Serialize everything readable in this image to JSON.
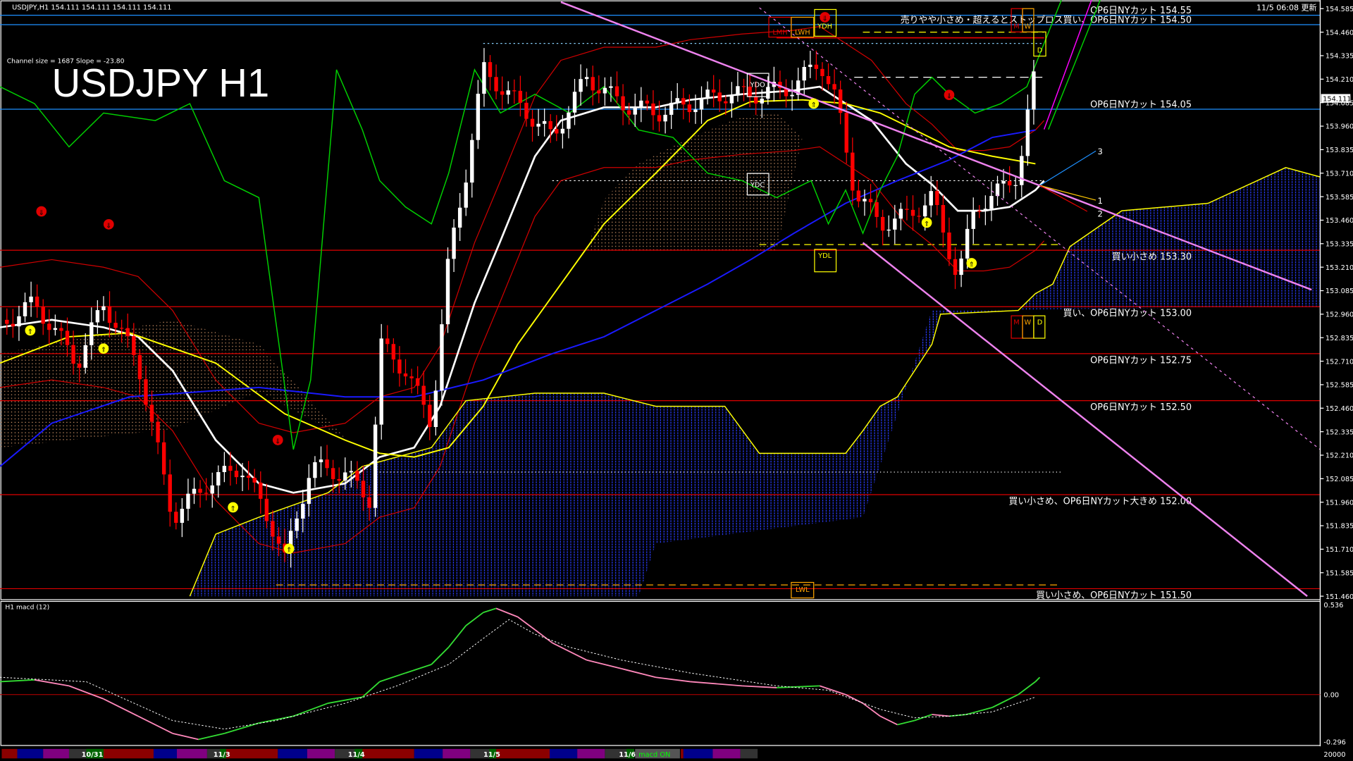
{
  "header": {
    "symbol_info": "USDJPY,H1  154.111 154.111 154.111 154.111",
    "channel_info": "Channel size = 1687 Slope = -23.80",
    "title": "USDJPY H1",
    "updated": "11/5 06:08 更新"
  },
  "levels": [
    {
      "price": 154.55,
      "label": "OP6日NYカット 154.55",
      "color": "#1e90ff"
    },
    {
      "price": 154.5,
      "label": "売りやや小さめ・超えるとストップロス買い、OP6日NYカット 154.50",
      "color": "#1e90ff"
    },
    {
      "price": 154.05,
      "label": "OP6日NYカット 154.05",
      "color": "#1e90ff"
    },
    {
      "price": 153.3,
      "label": "買い小さめ 153.30",
      "color": "#e00000"
    },
    {
      "price": 153.0,
      "label": "買い、OP6日NYカット 153.00",
      "color": "#e00000"
    },
    {
      "price": 152.75,
      "label": "OP6日NYカット 152.75",
      "color": "#e00000"
    },
    {
      "price": 152.5,
      "label": "OP6日NYカット 152.50",
      "color": "#e00000"
    },
    {
      "price": 152.0,
      "label": "買い小さめ、OP6日NYカット大きめ 152.00",
      "color": "#e00000"
    },
    {
      "price": 151.5,
      "label": "買い小さめ、OP6日NYカット 151.50",
      "color": "#e00000"
    }
  ],
  "markers": {
    "lmh": "LMH",
    "lwh": "LWH",
    "ydh": "YDH",
    "ydo": "YDO",
    "ydc": "YDC",
    "ydl": "YDL",
    "lwl": "LWL",
    "m": "M",
    "w": "W",
    "d": "D",
    "proj1": "1",
    "proj2": "2",
    "proj3": "3"
  },
  "current_price": "154.111",
  "macd": {
    "label": "H1  macd (12)",
    "axis_top": "0.536",
    "axis_zero": "0.00",
    "axis_bottom": "-0.296",
    "volume_label": "20000"
  },
  "timeline": {
    "days": [
      "10/31",
      "11/3",
      "11/4",
      "11/5",
      "11/6"
    ],
    "macd_toggle": "macd ON"
  },
  "chart_data": {
    "type": "candlestick",
    "title": "USDJPY H1",
    "ylim": [
      151.46,
      154.585
    ],
    "yticks": [
      "154.585",
      "154.460",
      "154.335",
      "154.210",
      "154.085",
      "153.960",
      "153.835",
      "153.710",
      "153.585",
      "153.460",
      "153.335",
      "153.210",
      "153.085",
      "152.960",
      "152.835",
      "152.710",
      "152.585",
      "152.460",
      "152.335",
      "152.210",
      "152.085",
      "151.960",
      "151.835",
      "151.710",
      "151.585",
      "151.460"
    ],
    "xlim_bars": [
      0,
      153
    ],
    "price_path": [
      [
        1,
        152.93
      ],
      [
        4,
        153.02
      ],
      [
        9,
        152.7
      ],
      [
        12,
        153.02
      ],
      [
        16,
        152.7
      ],
      [
        20,
        151.88
      ],
      [
        24,
        152.06
      ],
      [
        28,
        152.15
      ],
      [
        32,
        151.79
      ],
      [
        33,
        151.65
      ],
      [
        36,
        152.15
      ],
      [
        40,
        152.11
      ],
      [
        43,
        151.97
      ],
      [
        44,
        152.8
      ],
      [
        47,
        152.66
      ],
      [
        50,
        152.38
      ],
      [
        52,
        153.25
      ],
      [
        54,
        153.71
      ],
      [
        56,
        154.26
      ],
      [
        60,
        154.08
      ],
      [
        64,
        153.9
      ],
      [
        68,
        154.22
      ],
      [
        72,
        154.08
      ],
      [
        76,
        154.03
      ],
      [
        80,
        154.08
      ],
      [
        84,
        154.13
      ],
      [
        88,
        154.13
      ],
      [
        92,
        154.17
      ],
      [
        95,
        154.31
      ],
      [
        97,
        154.08
      ],
      [
        99,
        153.62
      ],
      [
        102,
        153.44
      ],
      [
        105,
        153.48
      ],
      [
        108,
        153.58
      ],
      [
        111,
        153.16
      ],
      [
        113,
        153.53
      ],
      [
        116,
        153.62
      ],
      [
        118,
        153.71
      ],
      [
        120,
        154.26
      ],
      [
        120.5,
        154.11
      ]
    ],
    "series": [
      {
        "name": "ma-white",
        "color": "#ffffff",
        "points": [
          [
            0,
            152.89
          ],
          [
            6,
            152.93
          ],
          [
            12,
            152.89
          ],
          [
            16,
            152.84
          ],
          [
            20,
            152.66
          ],
          [
            25,
            152.29
          ],
          [
            30,
            152.06
          ],
          [
            34,
            152.01
          ],
          [
            40,
            152.06
          ],
          [
            44,
            152.2
          ],
          [
            48,
            152.25
          ],
          [
            51,
            152.47
          ],
          [
            55,
            153.02
          ],
          [
            58,
            153.35
          ],
          [
            62,
            153.8
          ],
          [
            65,
            153.99
          ],
          [
            70,
            154.06
          ],
          [
            76,
            154.06
          ],
          [
            80,
            154.1
          ],
          [
            86,
            154.13
          ],
          [
            92,
            154.15
          ],
          [
            95,
            154.17
          ],
          [
            98,
            154.08
          ],
          [
            101,
            153.99
          ],
          [
            105,
            153.76
          ],
          [
            108,
            153.65
          ],
          [
            111,
            153.51
          ],
          [
            114,
            153.51
          ],
          [
            117,
            153.53
          ],
          [
            120,
            153.62
          ],
          [
            121,
            153.67
          ]
        ]
      },
      {
        "name": "ma-yellow",
        "color": "#ffff00",
        "points": [
          [
            0,
            152.7
          ],
          [
            8,
            152.84
          ],
          [
            15,
            152.86
          ],
          [
            25,
            152.7
          ],
          [
            33,
            152.43
          ],
          [
            40,
            152.29
          ],
          [
            44,
            152.22
          ],
          [
            48,
            152.2
          ],
          [
            52,
            152.25
          ],
          [
            56,
            152.47
          ],
          [
            60,
            152.8
          ],
          [
            65,
            153.12
          ],
          [
            70,
            153.44
          ],
          [
            76,
            153.71
          ],
          [
            82,
            153.99
          ],
          [
            87,
            154.09
          ],
          [
            93,
            154.1
          ],
          [
            98,
            154.08
          ],
          [
            102,
            154.03
          ],
          [
            106,
            153.94
          ],
          [
            110,
            153.85
          ],
          [
            115,
            153.8
          ],
          [
            120,
            153.76
          ]
        ]
      },
      {
        "name": "ma-blue",
        "color": "#1a1aff",
        "points": [
          [
            0,
            152.15
          ],
          [
            6,
            152.38
          ],
          [
            15,
            152.52
          ],
          [
            30,
            152.57
          ],
          [
            40,
            152.52
          ],
          [
            48,
            152.52
          ],
          [
            56,
            152.61
          ],
          [
            64,
            152.75
          ],
          [
            70,
            152.84
          ],
          [
            76,
            152.98
          ],
          [
            82,
            153.12
          ],
          [
            87,
            153.25
          ],
          [
            92,
            153.39
          ],
          [
            98,
            153.55
          ],
          [
            104,
            153.67
          ],
          [
            110,
            153.78
          ],
          [
            115,
            153.9
          ],
          [
            120,
            153.94
          ]
        ]
      },
      {
        "name": "chikou-green",
        "color": "#00d000",
        "points": [
          [
            0,
            154.17
          ],
          [
            4,
            154.08
          ],
          [
            8,
            153.85
          ],
          [
            12,
            154.03
          ],
          [
            18,
            153.99
          ],
          [
            22,
            154.08
          ],
          [
            26,
            153.67
          ],
          [
            30,
            153.58
          ],
          [
            34,
            152.24
          ],
          [
            36,
            152.61
          ],
          [
            39,
            154.26
          ],
          [
            42,
            153.94
          ],
          [
            44,
            153.67
          ],
          [
            47,
            153.53
          ],
          [
            50,
            153.44
          ],
          [
            52,
            153.71
          ],
          [
            55,
            154.26
          ],
          [
            58,
            154.03
          ],
          [
            62,
            154.13
          ],
          [
            66,
            154.03
          ],
          [
            70,
            154.17
          ],
          [
            74,
            153.94
          ],
          [
            78,
            153.9
          ],
          [
            82,
            153.71
          ],
          [
            86,
            153.67
          ],
          [
            90,
            153.58
          ],
          [
            94,
            153.67
          ],
          [
            96,
            153.44
          ],
          [
            98,
            153.62
          ],
          [
            100,
            153.39
          ],
          [
            102,
            153.62
          ],
          [
            104,
            153.8
          ],
          [
            106,
            154.13
          ],
          [
            108,
            154.22
          ],
          [
            110,
            154.13
          ],
          [
            113,
            154.03
          ],
          [
            116,
            154.08
          ],
          [
            119,
            154.17
          ],
          [
            123,
            154.63
          ]
        ]
      },
      {
        "name": "cloud-span",
        "color": "#ffff00",
        "points": [
          [
            22,
            151.46
          ],
          [
            25,
            151.79
          ],
          [
            30,
            151.88
          ],
          [
            38,
            152.01
          ],
          [
            42,
            152.15
          ],
          [
            50,
            152.25
          ],
          [
            54,
            152.5
          ],
          [
            62,
            152.54
          ],
          [
            70,
            152.54
          ],
          [
            76,
            152.47
          ],
          [
            84,
            152.47
          ],
          [
            88,
            152.22
          ],
          [
            98,
            152.22
          ],
          [
            100,
            152.34
          ],
          [
            102,
            152.47
          ],
          [
            104,
            152.52
          ],
          [
            106,
            152.66
          ],
          [
            108,
            152.8
          ],
          [
            109,
            152.96
          ],
          [
            118,
            152.98
          ],
          [
            120,
            153.07
          ],
          [
            122,
            153.12
          ],
          [
            124,
            153.32
          ],
          [
            130,
            153.51
          ],
          [
            140,
            153.55
          ],
          [
            149,
            153.74
          ],
          [
            153,
            153.69
          ]
        ]
      }
    ],
    "cloud_lower": [
      [
        153,
        153.0
      ],
      [
        108,
        152.98
      ],
      [
        100,
        151.88
      ],
      [
        76,
        151.74
      ],
      [
        74,
        151.46
      ],
      [
        22,
        151.46
      ]
    ],
    "orange_cloud": [
      [
        68,
        153.3
      ],
      [
        70,
        153.57
      ],
      [
        74,
        153.76
      ],
      [
        80,
        153.9
      ],
      [
        86,
        154.01
      ],
      [
        90,
        154.03
      ],
      [
        93,
        153.9
      ],
      [
        90,
        153.3
      ]
    ],
    "orange_cloud_left": [
      [
        0,
        152.75
      ],
      [
        20,
        152.93
      ],
      [
        30,
        152.8
      ],
      [
        40,
        152.3
      ],
      [
        30,
        152.55
      ],
      [
        20,
        152.35
      ],
      [
        0,
        152.25
      ]
    ],
    "trendlines": [
      {
        "name": "channel-upper",
        "from": [
          65,
          154.62
        ],
        "to": [
          152,
          153.09
        ]
      },
      {
        "name": "channel-lower",
        "from": [
          100,
          153.34
        ],
        "to": [
          151.5,
          151.46
        ]
      },
      {
        "name": "channel-mid",
        "from": [
          88,
          154.59
        ],
        "to": [
          153,
          152.24
        ],
        "dashed": true
      }
    ],
    "macd_series": {
      "ylim": [
        -0.296,
        0.536
      ],
      "macd": [
        [
          0,
          0.077
        ],
        [
          4,
          0.088
        ],
        [
          8,
          0.052
        ],
        [
          12,
          -0.026
        ],
        [
          16,
          -0.129
        ],
        [
          20,
          -0.232
        ],
        [
          23,
          -0.268
        ],
        [
          26,
          -0.232
        ],
        [
          30,
          -0.17
        ],
        [
          34,
          -0.129
        ],
        [
          38,
          -0.052
        ],
        [
          42,
          -0.015
        ],
        [
          44,
          0.077
        ],
        [
          47,
          0.129
        ],
        [
          50,
          0.18
        ],
        [
          52,
          0.283
        ],
        [
          54,
          0.412
        ],
        [
          56,
          0.49
        ],
        [
          57.5,
          0.515
        ],
        [
          60,
          0.464
        ],
        [
          62,
          0.387
        ],
        [
          64,
          0.309
        ],
        [
          68,
          0.206
        ],
        [
          72,
          0.155
        ],
        [
          76,
          0.103
        ],
        [
          80,
          0.077
        ],
        [
          86,
          0.052
        ],
        [
          90,
          0.041
        ],
        [
          95,
          0.052
        ],
        [
          98,
          0.0
        ],
        [
          100,
          -0.052
        ],
        [
          102,
          -0.129
        ],
        [
          104,
          -0.18
        ],
        [
          106,
          -0.155
        ],
        [
          108,
          -0.119
        ],
        [
          110,
          -0.129
        ],
        [
          112,
          -0.119
        ],
        [
          115,
          -0.077
        ],
        [
          118,
          0.0
        ],
        [
          120,
          0.077
        ],
        [
          120.5,
          0.103
        ]
      ],
      "signal": [
        [
          0,
          0.103
        ],
        [
          10,
          0.077
        ],
        [
          20,
          -0.155
        ],
        [
          26,
          -0.206
        ],
        [
          32,
          -0.155
        ],
        [
          40,
          -0.052
        ],
        [
          46,
          0.052
        ],
        [
          52,
          0.18
        ],
        [
          56,
          0.335
        ],
        [
          59,
          0.448
        ],
        [
          62,
          0.361
        ],
        [
          66,
          0.283
        ],
        [
          72,
          0.206
        ],
        [
          80,
          0.129
        ],
        [
          90,
          0.052
        ],
        [
          96,
          0.026
        ],
        [
          102,
          -0.088
        ],
        [
          106,
          -0.139
        ],
        [
          110,
          -0.129
        ],
        [
          115,
          -0.103
        ],
        [
          120,
          -0.015
        ]
      ]
    }
  }
}
